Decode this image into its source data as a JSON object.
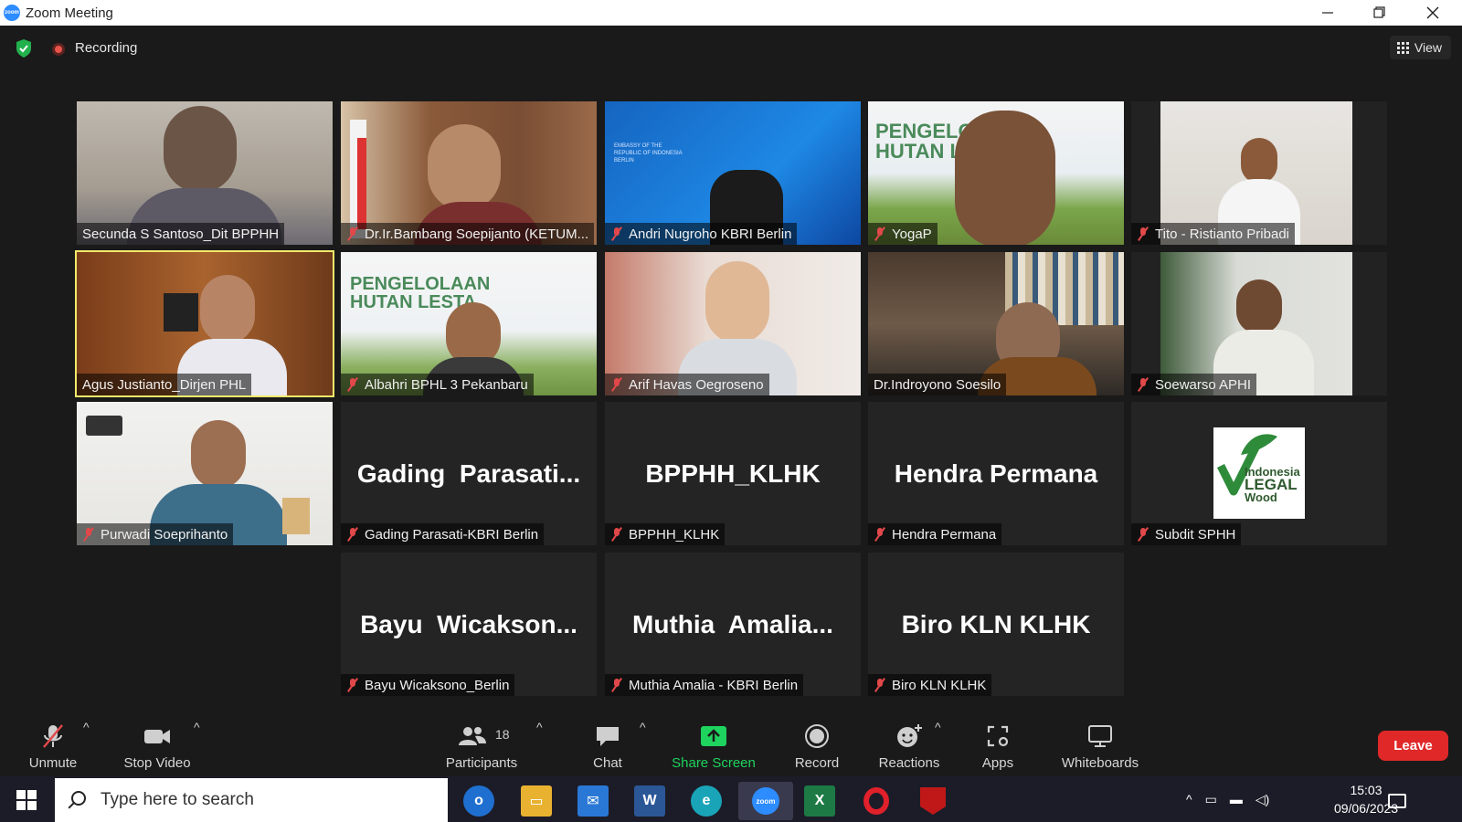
{
  "window": {
    "title": "Zoom Meeting",
    "logo_text": "zoom"
  },
  "topbar": {
    "recording_label": "Recording",
    "view_label": "View"
  },
  "participants": [
    {
      "name": "Secunda S Santoso_Dit BPPHH",
      "muted": false,
      "display": "video"
    },
    {
      "name": "Dr.Ir.Bambang Soepijanto (KETUM...",
      "muted": true,
      "display": "video"
    },
    {
      "name": "Andri Nugroho KBRI Berlin",
      "muted": true,
      "display": "video"
    },
    {
      "name": "YogaP",
      "muted": true,
      "display": "video"
    },
    {
      "name": "Tito - Ristianto Pribadi",
      "muted": true,
      "display": "video"
    },
    {
      "name": "Agus Justianto_Dirjen PHL",
      "muted": false,
      "display": "video",
      "active_speaker": true
    },
    {
      "name": "Albahri BPHL 3 Pekanbaru",
      "muted": true,
      "display": "video"
    },
    {
      "name": "Arif Havas Oegroseno",
      "muted": true,
      "display": "video"
    },
    {
      "name": "Dr.Indroyono Soesilo",
      "muted": false,
      "display": "video"
    },
    {
      "name": "Soewarso APHI",
      "muted": true,
      "display": "video"
    },
    {
      "name": "Purwadi Soeprihanto",
      "muted": true,
      "display": "video"
    },
    {
      "name": "Gading Parasati-KBRI Berlin",
      "muted": true,
      "display": "name",
      "big_name": "Gading  Parasati..."
    },
    {
      "name": "BPPHH_KLHK",
      "muted": true,
      "display": "name",
      "big_name": "BPPHH_KLHK"
    },
    {
      "name": "Hendra Permana",
      "muted": true,
      "display": "name",
      "big_name": "Hendra Permana"
    },
    {
      "name": "Subdit SPHH",
      "muted": true,
      "display": "logo",
      "logo_text": [
        "Indonesia",
        "LEGAL",
        "Wood"
      ]
    },
    {
      "name": "Bayu Wicaksono_Berlin",
      "muted": true,
      "display": "name",
      "big_name": "Bayu  Wicakson..."
    },
    {
      "name": "Muthia Amalia - KBRI Berlin",
      "muted": true,
      "display": "name",
      "big_name": "Muthia  Amalia..."
    },
    {
      "name": "Biro KLN KLHK",
      "muted": true,
      "display": "name",
      "big_name": "Biro KLN KLHK"
    }
  ],
  "toolbar": {
    "unmute": "Unmute",
    "stop_video": "Stop Video",
    "participants": "Participants",
    "participants_count": "18",
    "chat": "Chat",
    "share_screen": "Share Screen",
    "record": "Record",
    "reactions": "Reactions",
    "apps": "Apps",
    "whiteboards": "Whiteboards",
    "leave": "Leave"
  },
  "taskbar": {
    "search_placeholder": "Type here to search",
    "time": "15:03",
    "date": "09/06/2023",
    "apps": [
      "outlook",
      "file-explorer",
      "mail",
      "word",
      "edge",
      "zoom",
      "excel",
      "opera",
      "mcafee"
    ]
  },
  "colors": {
    "active_speaker": "#f2e96b",
    "share_green": "#1ed35e",
    "leave_red": "#e02828",
    "mute_red": "#e0484a"
  }
}
